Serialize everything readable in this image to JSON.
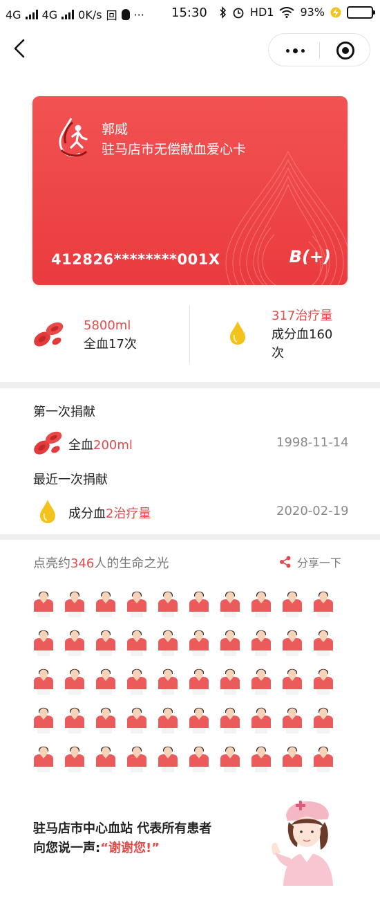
{
  "status_bar": {
    "net1": "4G",
    "net2": "4G",
    "speed": "0K/s",
    "extra": "回",
    "dots": "···",
    "time": "15:30",
    "hd": "HD1",
    "battery": "93%",
    "battery_color": "#2db84b"
  },
  "nav": {
    "back_icon": "chevron-left-icon",
    "more_icon": "more-dots-icon",
    "target_icon": "target-icon"
  },
  "card": {
    "name": "郭威",
    "title": "驻马店市无偿献血爱心卡",
    "id_number": "412826********001X",
    "blood_type": "B(+)",
    "color": "#ea3b3f"
  },
  "stats": {
    "whole_blood_amount": "5800ml",
    "whole_blood_count": "全血17次",
    "component_amount": "317治疗量",
    "component_count_line1": "成分血160",
    "component_count_line2": "次"
  },
  "history": {
    "first_title": "第一次捐献",
    "first_type": "全血",
    "first_amount": "200ml",
    "first_date": "1998-11-14",
    "latest_title": "最近一次捐献",
    "latest_type": "成分血",
    "latest_amount": "2治疗量",
    "latest_date": "2020-02-19"
  },
  "lights": {
    "prefix": "点亮约",
    "count": "346",
    "suffix": "人的生命之光",
    "share_label": "分享一下"
  },
  "thanks": {
    "line1": "驻马店市中心血站 代表所有患者",
    "line2_prefix": "向您说一声:",
    "line2_quote": "“谢谢您!”"
  },
  "colors": {
    "accent": "#e14c4c",
    "gold": "#f3c21c"
  }
}
